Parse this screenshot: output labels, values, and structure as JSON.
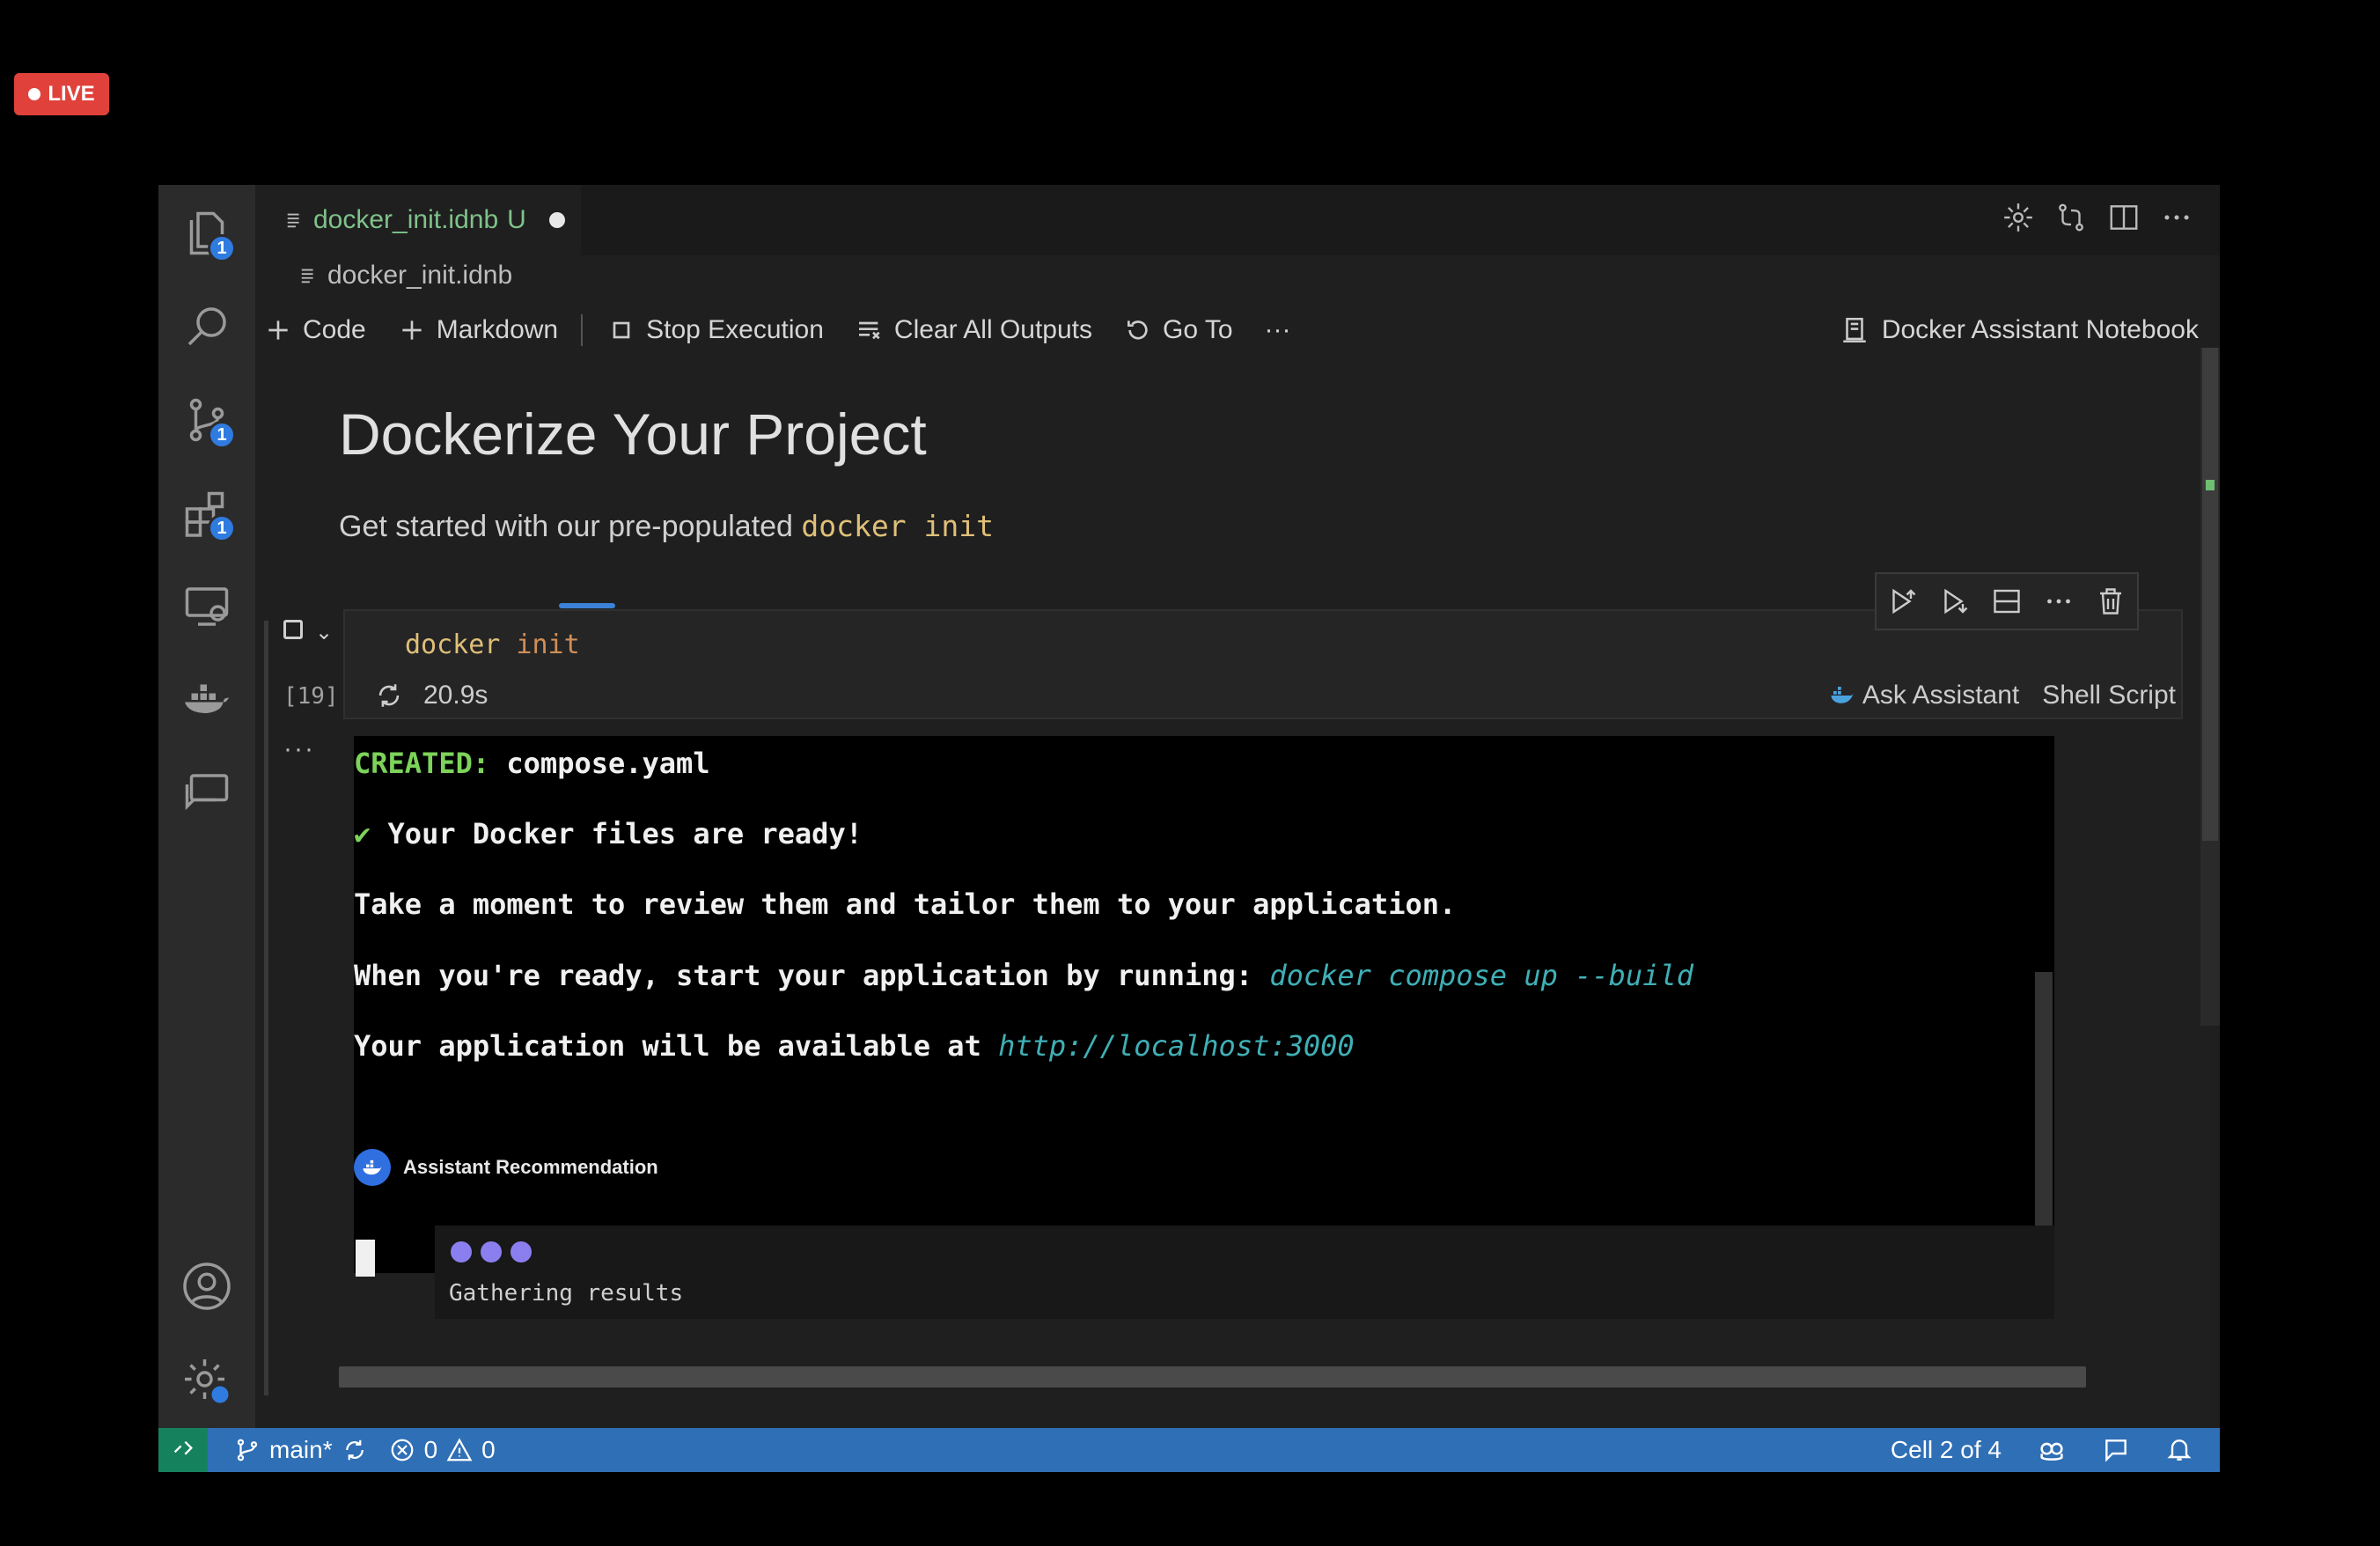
{
  "live_badge": "LIVE",
  "tab": {
    "filename": "docker_init.idnb",
    "status": "U"
  },
  "breadcrumb": "docker_init.idnb",
  "toolbar": {
    "code": "Code",
    "markdown": "Markdown",
    "stop": "Stop Execution",
    "clear": "Clear All Outputs",
    "goto": "Go To",
    "more": "···",
    "kernel": "Docker Assistant Notebook"
  },
  "activity_badges": {
    "explorer": "1",
    "scm": "1",
    "extensions": "1"
  },
  "notebook": {
    "title": "Dockerize Your Project",
    "subtitle_text": "Get started with our pre-populated ",
    "subtitle_code": "docker init"
  },
  "cell": {
    "code_cmd": "docker",
    "code_arg": " init",
    "exec_count": "[19]",
    "duration": "20.9s",
    "ask": "Ask Assistant",
    "lang": "Shell Script",
    "more": "···"
  },
  "output": {
    "created_label": "CREATED:",
    "created_file": " compose.yaml",
    "check": "✔",
    "ready": " Your Docker files are ready!",
    "review": "Take a moment to review them and tailor them to your application.",
    "start_text": "When you're ready, start your application by running: ",
    "start_cmd": "docker compose up --build",
    "avail_text": "Your application will be available at ",
    "avail_url": "http://localhost:3000"
  },
  "recommendation": {
    "label": "Assistant Recommendation",
    "loading": "Gathering results"
  },
  "statusbar": {
    "branch": "main*",
    "errors": "0",
    "warnings": "0",
    "cell_pos": "Cell 2 of 4"
  }
}
